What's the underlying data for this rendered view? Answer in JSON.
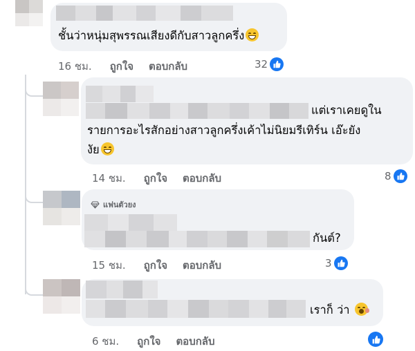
{
  "comments": [
    {
      "text_lines": [
        "ชั้นว่าหนุ่มสุพรรณเสียงดีกับสาวลูกครึ่ง"
      ],
      "emoji": "grinning-face-icon",
      "time": "16 ชม.",
      "like_label": "ถูกใจ",
      "reply_label": "ตอบกลับ",
      "reaction_count": "32"
    },
    {
      "text_lines": [
        "แต่เราเคยดูใน",
        "รายการอะไรสักอย่างสาวลูกครึ่งเค้าไม่นิยมรีเทิร์น เอ๊ะยัง",
        "งัย"
      ],
      "emoji": "grinning-face-icon",
      "time": "14 ชม.",
      "like_label": "ถูกใจ",
      "reply_label": "ตอบกลับ",
      "reaction_count": "8"
    },
    {
      "badge": "แฟนตัวยง",
      "badge_icon": "diamond-icon",
      "text_lines": [
        "กันต์?"
      ],
      "time": "15 ชม.",
      "like_label": "ถูกใจ",
      "reply_label": "ตอบกลับ",
      "reaction_count": "3"
    },
    {
      "text_lines": [
        "เราก็ ว่า"
      ],
      "emoji": "flushed-face-icon",
      "time": "6 ชม.",
      "like_label": "ถูกใจ",
      "reply_label": "ตอบกลับ",
      "reaction_count": ""
    }
  ],
  "colors": {
    "bubble": "#f0f2f5",
    "meta_text": "#65676b",
    "like_blue": "#1877f2",
    "thread_line": "#d6d9de"
  }
}
